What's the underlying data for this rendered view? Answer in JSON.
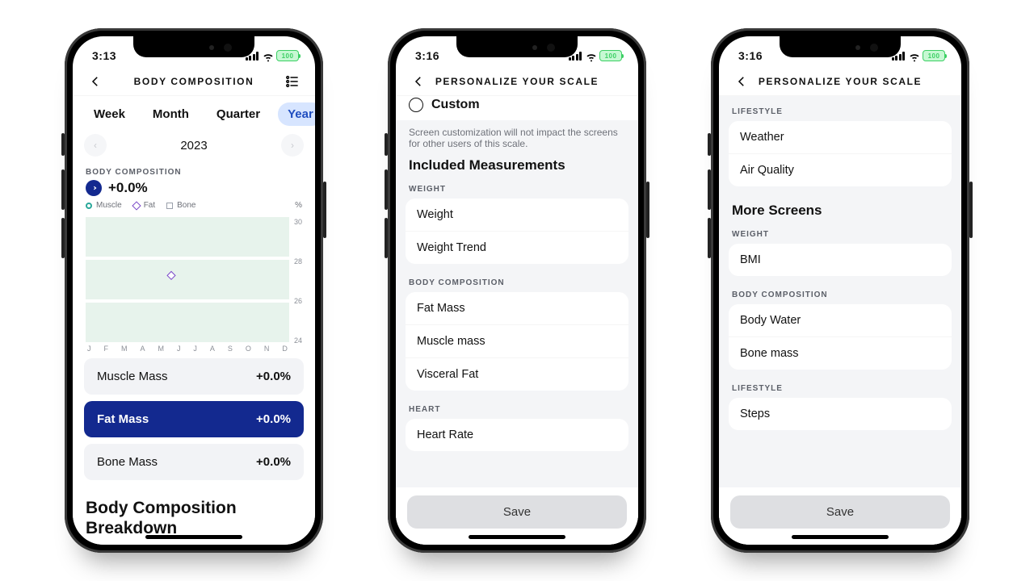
{
  "status": {
    "time1": "3:13",
    "time2": "3:16",
    "time3": "3:16",
    "battery": "100"
  },
  "bodycomp": {
    "title": "BODY COMPOSITION",
    "tabs": [
      "Week",
      "Month",
      "Quarter",
      "Year"
    ],
    "active_tab": 3,
    "prev_icon": "‹",
    "next_icon": "›",
    "year": "2023",
    "section_label": "BODY COMPOSITION",
    "delta": "+0.0%",
    "legend": {
      "muscle": "Muscle",
      "fat": "Fat",
      "bone": "Bone",
      "unit": "%"
    },
    "yticks": [
      "30",
      "28",
      "26",
      "24"
    ],
    "months": [
      "J",
      "F",
      "M",
      "A",
      "M",
      "J",
      "J",
      "A",
      "S",
      "O",
      "N",
      "D"
    ],
    "stats": [
      {
        "label": "Muscle Mass",
        "value": "+0.0%",
        "strong": false
      },
      {
        "label": "Fat Mass",
        "value": "+0.0%",
        "strong": true
      },
      {
        "label": "Bone Mass",
        "value": "+0.0%",
        "strong": false
      }
    ],
    "breakdown_title": "Body Composition Breakdown"
  },
  "personalize": {
    "title": "PERSONALIZE YOUR SCALE",
    "custom": "Custom",
    "help": "Screen customization will not impact the screens for other users of this scale.",
    "h_included": "Included Measurements",
    "weight_label": "WEIGHT",
    "weight_items": [
      "Weight",
      "Weight Trend"
    ],
    "bc_label": "BODY COMPOSITION",
    "bc_items": [
      "Fat Mass",
      "Muscle mass",
      "Visceral Fat"
    ],
    "heart_label": "HEART",
    "heart_items": [
      "Heart Rate"
    ],
    "save": "Save"
  },
  "personalize2": {
    "title": "PERSONALIZE YOUR SCALE",
    "lifestyle_label": "LIFESTYLE",
    "lifestyle_items": [
      "Weather",
      "Air Quality"
    ],
    "h_more": "More Screens",
    "weight_label": "WEIGHT",
    "weight_items": [
      "BMI"
    ],
    "bc_label": "BODY COMPOSITION",
    "bc_items": [
      "Body Water",
      "Bone mass"
    ],
    "lifestyle2_label": "LIFESTYLE",
    "lifestyle2_items": [
      "Steps"
    ],
    "save": "Save"
  },
  "chart_data": {
    "type": "line",
    "title": "Body Composition",
    "xlabel": "",
    "ylabel": "%",
    "ylim": [
      24,
      30
    ],
    "categories": [
      "J",
      "F",
      "M",
      "A",
      "M",
      "J",
      "J",
      "A",
      "S",
      "O",
      "N",
      "D"
    ],
    "series": [
      {
        "name": "Muscle",
        "values": [
          null,
          null,
          null,
          null,
          null,
          null,
          null,
          null,
          null,
          null,
          null,
          null
        ]
      },
      {
        "name": "Fat",
        "values": [
          null,
          null,
          null,
          null,
          27,
          null,
          null,
          null,
          null,
          null,
          null,
          null
        ]
      },
      {
        "name": "Bone",
        "values": [
          null,
          null,
          null,
          null,
          null,
          null,
          null,
          null,
          null,
          null,
          null,
          null
        ]
      }
    ]
  }
}
